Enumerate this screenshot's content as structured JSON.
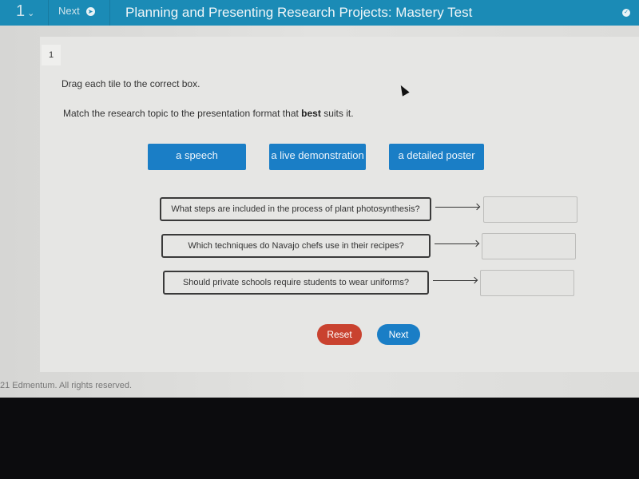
{
  "topbar": {
    "question_number": "1",
    "next_label": "Next",
    "title": "Planning and Presenting Research Projects: Mastery Test"
  },
  "question": {
    "number": "1",
    "instruction": "Drag each tile to the correct box.",
    "prompt_before": "Match the research topic to the presentation format that ",
    "prompt_bold": "best",
    "prompt_after": " suits it.",
    "tiles": [
      "a speech",
      "a live demonstration",
      "a detailed poster"
    ],
    "topics": [
      "What steps are included in the process of plant photosynthesis?",
      "Which techniques do Navajo chefs use in their recipes?",
      "Should private schools require students to wear uniforms?"
    ]
  },
  "buttons": {
    "reset": "Reset",
    "next": "Next",
    "reset_color": "#c9422f",
    "next_color": "#1a7ec6"
  },
  "footer": "21 Edmentum. All rights reserved."
}
